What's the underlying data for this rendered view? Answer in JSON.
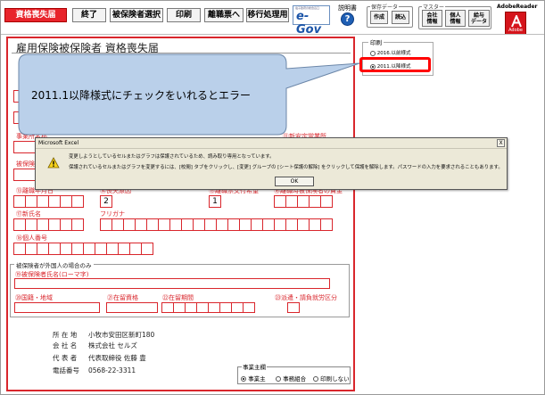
{
  "toolbar": {
    "app_title": "資格喪失届",
    "buttons": [
      "終了",
      "被保険者選択",
      "印刷",
      "離職票へ",
      "移行処理用"
    ],
    "egov": "e-Gov",
    "egov_sub": "電子政府の総合窓口",
    "help_label": "説明書",
    "help_icon": "?",
    "save_group": "保存データ",
    "save_create": "作成",
    "save_read": "読込",
    "master_group": "マスター",
    "master_company": "会社\n情報",
    "master_person": "個人\n情報",
    "master_salary": "給与\nデータ",
    "adobe_label": "AdobeReader",
    "adobe_text": "Adobe"
  },
  "form": {
    "title": "雇用保険被保険者  資格喪失届",
    "labels": {
      "office_name": "事業所名称",
      "new_office": "⑪新安定営業所",
      "insured": "被保険",
      "f13": "⑬離職年月日",
      "f14": "⑭喪失原因",
      "f15": "⑮離職票交付希望",
      "f16": "⑯離職時被保険者の賃金",
      "f17": "⑰新氏名",
      "kana": "フリガナ",
      "f18": "⑱個人番号"
    },
    "cell_loss_reason": "2",
    "cell_certificate": "1",
    "foreign": {
      "group_title": "被保険者が外国人の場合のみ",
      "f19": "⑲被保険者氏名(ローマ字)",
      "f20": "⑳国籍・地域",
      "f21": "㉑在留資格",
      "f22": "㉒在留期間",
      "f23": "㉓派遣・請負就労区分"
    },
    "company": {
      "address_label": "所 在 地",
      "address_value": "小牧市安田区新町180",
      "name_label": "会 社 名",
      "name_value": "株式会社 セルズ",
      "rep_label": "代 表 者",
      "rep_value": "代表取締役 佐藤 豊",
      "tel_label": "電話番号",
      "tel_value": "0568-22-3311"
    },
    "employer": {
      "title": "事業主欄",
      "opt1": "事業主",
      "opt2": "事務組合",
      "opt3": "印刷しない"
    }
  },
  "print_panel": {
    "title": "印刷",
    "opt_old": "2016.以前様式",
    "opt_new": "2011.以降様式"
  },
  "callout": {
    "text": "2011.1以降様式にチェックをいれるとエラー"
  },
  "dialog": {
    "title": "Microsoft Excel",
    "close": "X",
    "line1": "変更しようとしているセルまたはグラフは保護されているため、読み取り専用となっています。",
    "line2": "保護されているセルまたはグラフを変更するには、[校閲] タブをクリックし、[変更] グループの [シート保護の解除] をクリックして保護を解除します。パスワードの入力を要求されることもあります。",
    "ok": "OK"
  },
  "colors": {
    "accent": "#e8242b",
    "form_red": "#d9262c",
    "callout_fill": "#bad0ea",
    "highlight": "#ff0000"
  }
}
